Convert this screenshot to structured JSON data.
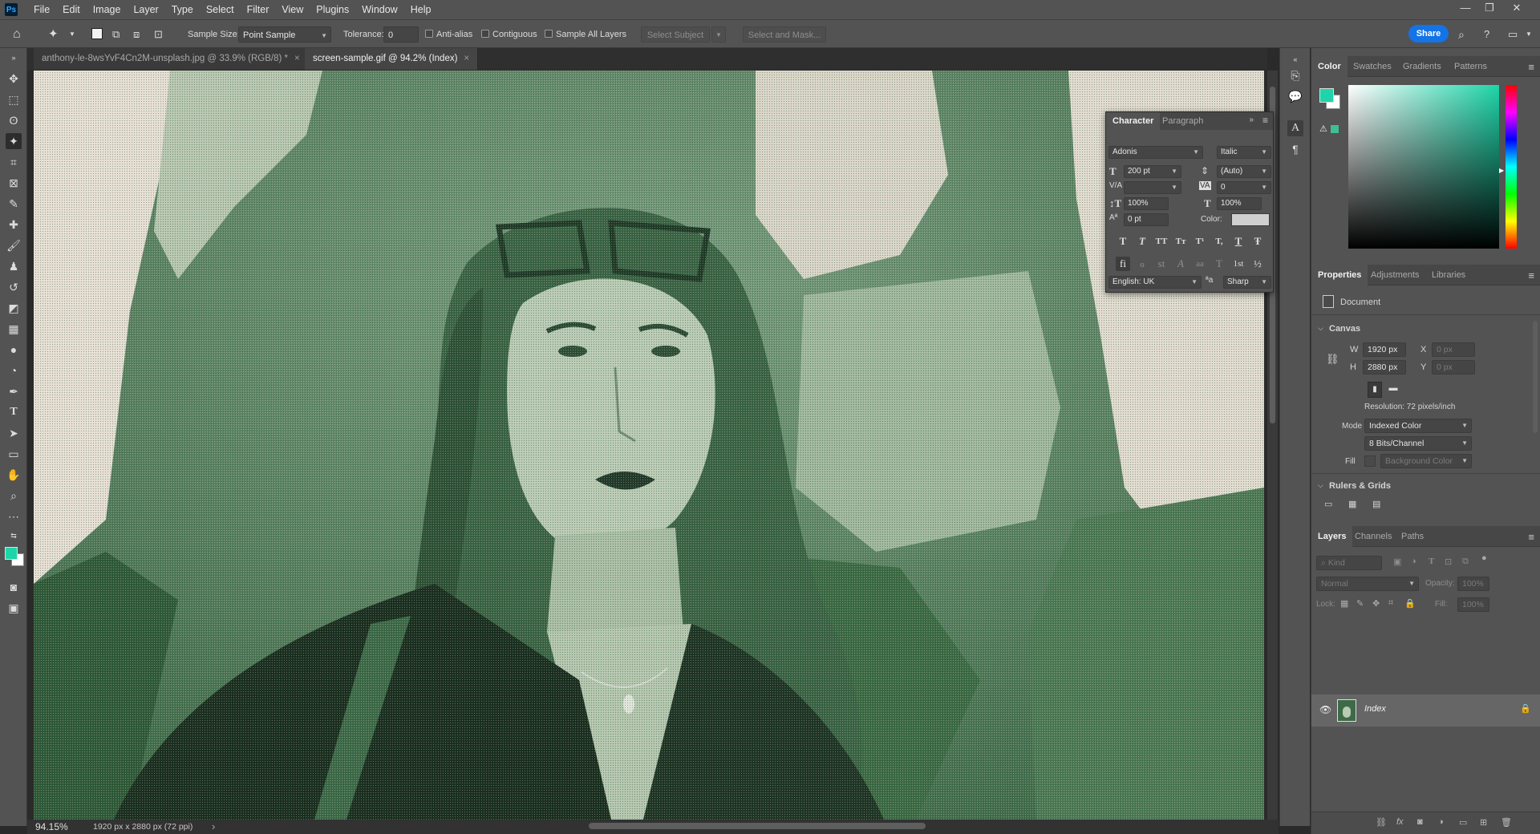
{
  "app": {
    "logo": "Ps"
  },
  "menu": [
    "File",
    "Edit",
    "Image",
    "Layer",
    "Type",
    "Select",
    "Filter",
    "View",
    "Plugins",
    "Window",
    "Help"
  ],
  "options_bar": {
    "sample_size_label": "Sample Size:",
    "sample_size_value": "Point Sample",
    "tolerance_label": "Tolerance:",
    "tolerance_value": "0",
    "anti_alias": "Anti-alias",
    "contiguous": "Contiguous",
    "sample_all_layers": "Sample All Layers",
    "select_subject": "Select Subject",
    "select_and_mask": "Select and Mask...",
    "share": "Share"
  },
  "tabs": [
    {
      "label": "anthony-le-8wsYvF4Cn2M-unsplash.jpg @ 33.9% (RGB/8) *",
      "close": "×"
    },
    {
      "label": "screen-sample.gif @ 94.2% (Index)",
      "close": "×"
    }
  ],
  "status": {
    "zoom": "94.15%",
    "doc_size": "1920 px x 2880 px (72 ppi)",
    "arrow": "›"
  },
  "character": {
    "tabs": [
      "Character",
      "Paragraph"
    ],
    "font_family": "Adonis",
    "font_style": "Italic",
    "size": "200 pt",
    "leading": "(Auto)",
    "kerning": "",
    "tracking": "0",
    "vscale": "100%",
    "hscale": "100%",
    "baseline": "0 pt",
    "color_label": "Color:",
    "language": "English: UK",
    "aa_label": "ªa",
    "antialias": "Sharp",
    "styles": [
      "T",
      "T",
      "TT",
      "Tт",
      "T¹",
      "T,",
      "T",
      "Ŧ"
    ],
    "otf": [
      "fi",
      "ℴ",
      "st",
      "A",
      "aa",
      "T",
      "1st",
      "½"
    ]
  },
  "color_panel": {
    "tabs": [
      "Color",
      "Swatches",
      "Gradients",
      "Patterns"
    ],
    "foreground": "#1ed5a9",
    "background": "#ffffff"
  },
  "properties": {
    "tabs": [
      "Properties",
      "Adjustments",
      "Libraries"
    ],
    "doc_label": "Document",
    "canvas_header": "Canvas",
    "w_label": "W",
    "w_value": "1920 px",
    "h_label": "H",
    "h_value": "2880 px",
    "x_label": "X",
    "x_value": "0 px",
    "y_label": "Y",
    "y_value": "0 px",
    "resolution": "Resolution: 72 pixels/inch",
    "mode_label": "Mode",
    "mode_value": "Indexed Color",
    "bits_value": "8 Bits/Channel",
    "fill_label": "Fill",
    "fill_value": "Background Color",
    "rulers_header": "Rulers & Grids"
  },
  "layers_panel": {
    "tabs": [
      "Layers",
      "Channels",
      "Paths"
    ],
    "kind_placeholder": "Kind",
    "blend_mode": "Normal",
    "opacity_label": "Opacity:",
    "opacity_value": "100%",
    "lock_label": "Lock:",
    "fill_label": "Fill:",
    "fill_value": "100%",
    "layer_name": "Index"
  }
}
